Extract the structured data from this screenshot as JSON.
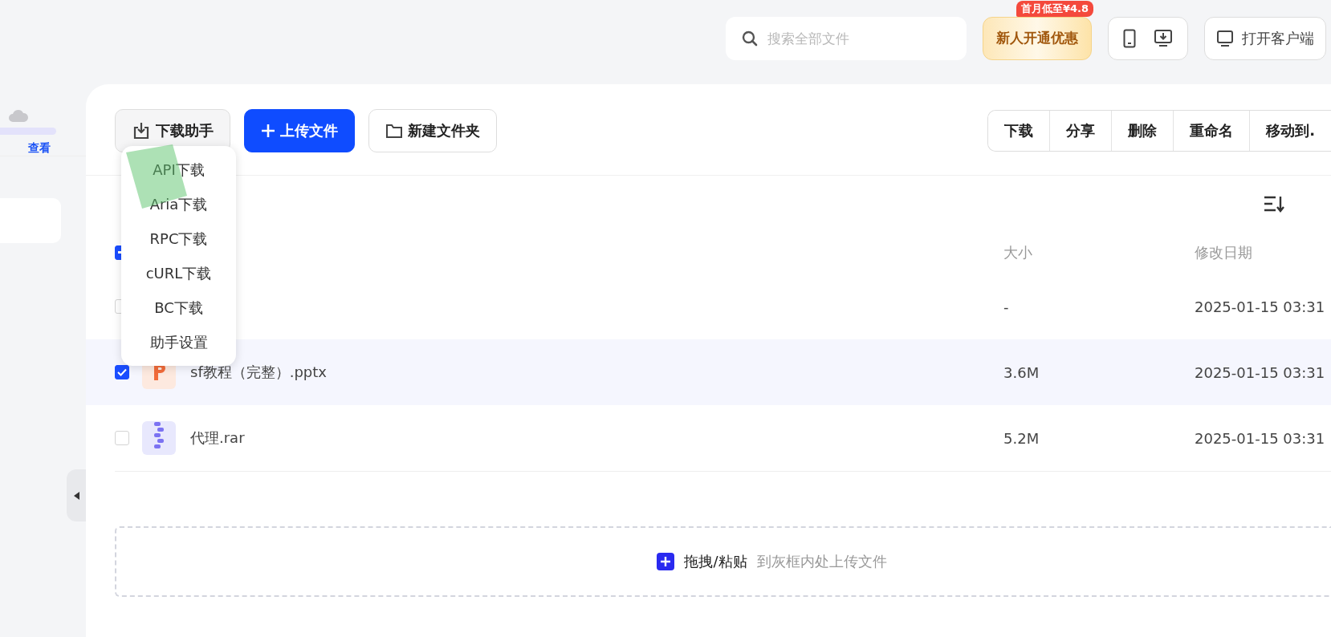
{
  "search": {
    "placeholder": "搜索全部文件"
  },
  "promo": {
    "label": "新人开通优惠",
    "badge": "首月低至¥4.8"
  },
  "client_button": {
    "label": "打开客户端"
  },
  "sidebar": {
    "storage_link": "查看"
  },
  "toolbar": {
    "helper_button": "下载助手",
    "upload_button": "上传文件",
    "new_folder_button": "新建文件夹"
  },
  "actions": [
    "下载",
    "分享",
    "删除",
    "重命名",
    "移动到."
  ],
  "helper_menu": {
    "expanded": true,
    "items": [
      "API下载",
      "Aria下载",
      "RPC下载",
      "cURL下载",
      "BC下载",
      "助手设置"
    ]
  },
  "table": {
    "header_checkbox": {
      "indeterminate": true
    },
    "columns": [
      "大小",
      "修改日期"
    ],
    "rows": [
      {
        "kind": "hidden",
        "size": "-",
        "date": "2025-01-15 03:31",
        "checked": false
      },
      {
        "name": "sf教程（完整）.pptx",
        "kind": "pptx",
        "size": "3.6M",
        "date": "2025-01-15 03:31",
        "checked": true
      },
      {
        "name": "代理.rar",
        "kind": "rar",
        "size": "5.2M",
        "date": "2025-01-15 03:31",
        "checked": false
      }
    ]
  },
  "dropzone": {
    "action": "拖拽/粘贴",
    "hint": "到灰框内处上传文件"
  }
}
